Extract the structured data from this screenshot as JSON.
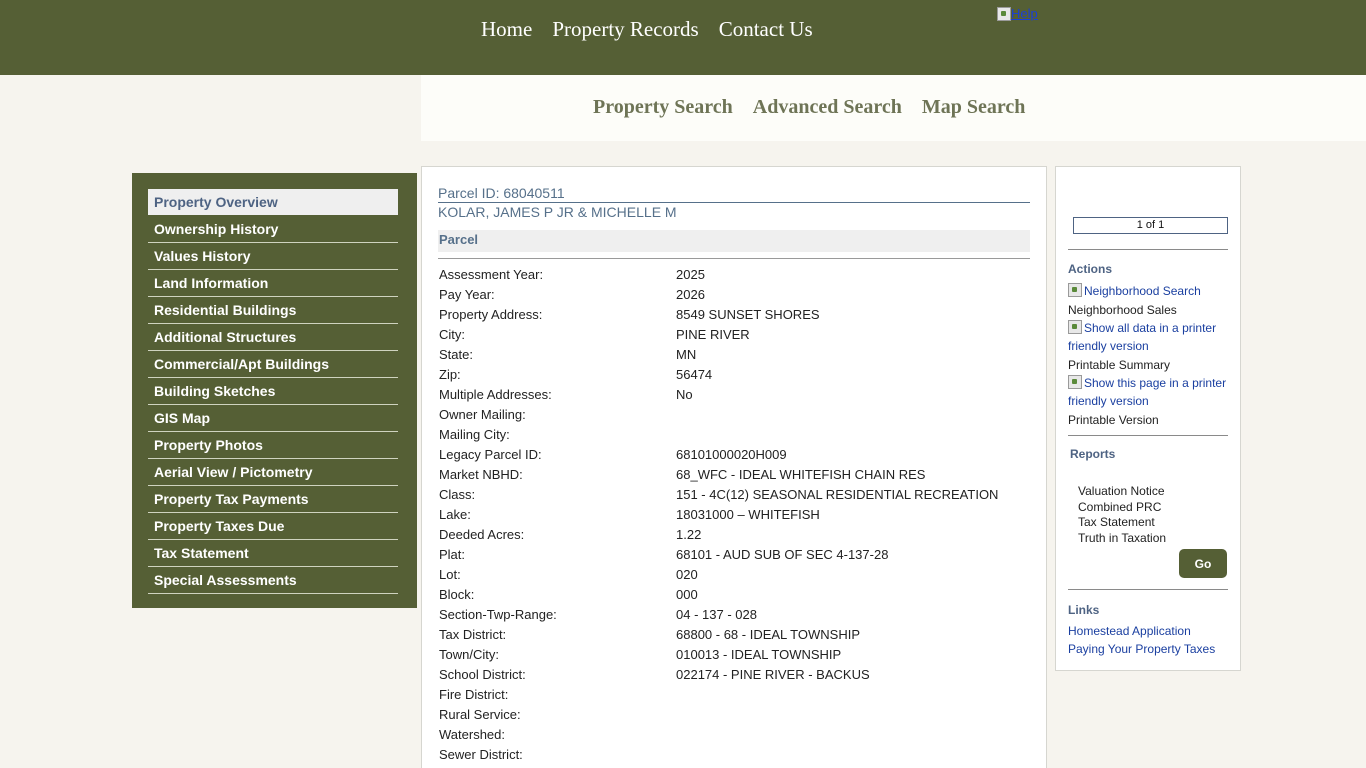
{
  "topnav": [
    "Home",
    "Property Records",
    "Contact Us"
  ],
  "help_label": "Help",
  "searchnav": [
    "Property Search",
    "Advanced Search",
    "Map Search"
  ],
  "sidebar": [
    "Property Overview",
    "Ownership History",
    "Values History",
    "Land Information",
    "Residential Buildings",
    "Additional Structures",
    "Commercial/Apt Buildings",
    "Building Sketches",
    "GIS Map",
    "Property Photos",
    "Aerial View / Pictometry",
    "Property Tax Payments",
    "Property Taxes Due",
    "Tax Statement",
    "Special Assessments"
  ],
  "parcel": {
    "id_line": "Parcel ID: 68040511",
    "owner": "KOLAR, JAMES P JR & MICHELLE M",
    "section_title": "Parcel",
    "rows": [
      {
        "label": "Assessment Year:",
        "value": "2025"
      },
      {
        "label": "Pay Year:",
        "value": "2026"
      },
      {
        "label": "Property Address:",
        "value": "8549 SUNSET SHORES"
      },
      {
        "label": "City:",
        "value": "PINE RIVER"
      },
      {
        "label": "State:",
        "value": "MN"
      },
      {
        "label": "Zip:",
        "value": "56474"
      },
      {
        "label": "Multiple Addresses:",
        "value": "No"
      },
      {
        "label": "Owner Mailing:",
        "value": ""
      },
      {
        "label": "Mailing City:",
        "value": ""
      },
      {
        "label": "Legacy Parcel ID:",
        "value": "68101000020H009"
      },
      {
        "label": "Market NBHD:",
        "value": "68_WFC - IDEAL WHITEFISH CHAIN RES"
      },
      {
        "label": "Class:",
        "value": "151 - 4C(12) SEASONAL RESIDENTIAL RECREATION"
      },
      {
        "label": "Lake:",
        "value": "18031000 – WHITEFISH"
      },
      {
        "label": "Deeded Acres:",
        "value": "1.22"
      },
      {
        "label": "Plat:",
        "value": "68101 - AUD SUB OF SEC 4-137-28"
      },
      {
        "label": "Lot:",
        "value": "020"
      },
      {
        "label": "Block:",
        "value": "000"
      },
      {
        "label": "Section-Twp-Range:",
        "value": "04 - 137 - 028"
      },
      {
        "label": "Tax District:",
        "value": "68800 - 68 - IDEAL TOWNSHIP"
      },
      {
        "label": "Town/City:",
        "value": "010013 - IDEAL TOWNSHIP"
      },
      {
        "label": "School District:",
        "value": "022174 - PINE RIVER - BACKUS"
      },
      {
        "label": "Fire District:",
        "value": ""
      },
      {
        "label": "Rural Service:",
        "value": ""
      },
      {
        "label": "Watershed:",
        "value": ""
      },
      {
        "label": "Sewer District:",
        "value": ""
      }
    ]
  },
  "right": {
    "pager": "1 of 1",
    "actions_title": "Actions",
    "neighborhood_alt": "Neighborhood Search",
    "neighborhood_label": "Neighborhood Sales",
    "print_all_alt": "Show all data in a printer friendly version",
    "print_all_label": "Printable Summary",
    "print_page_alt": "Show this page in a printer friendly version",
    "print_page_label": "Printable Version",
    "reports_title": "Reports",
    "reports": [
      "Valuation Notice",
      "Combined PRC",
      "Tax Statement",
      "Truth in Taxation"
    ],
    "go_label": "Go",
    "links_title": "Links",
    "links": [
      "Homestead Application",
      "Paying Your Property Taxes"
    ]
  }
}
